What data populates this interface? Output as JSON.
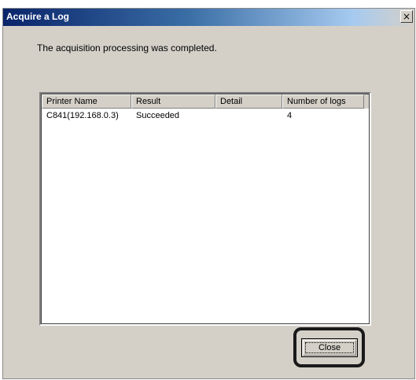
{
  "window": {
    "title": "Acquire a Log",
    "close_glyph": "×",
    "close_icon": "close-icon"
  },
  "message": "The acquisition processing was completed.",
  "table": {
    "columns": [
      "Printer Name",
      "Result",
      "Detail",
      "Number of logs"
    ],
    "rows": [
      [
        "C841(192.168.0.3)",
        "Succeeded",
        "",
        "4"
      ]
    ]
  },
  "buttons": {
    "close_label": "Close"
  },
  "colors": {
    "title_bar_start": "#0a246a",
    "title_bar_end": "#a6caf0",
    "dialog_face": "#d4d0c8"
  }
}
